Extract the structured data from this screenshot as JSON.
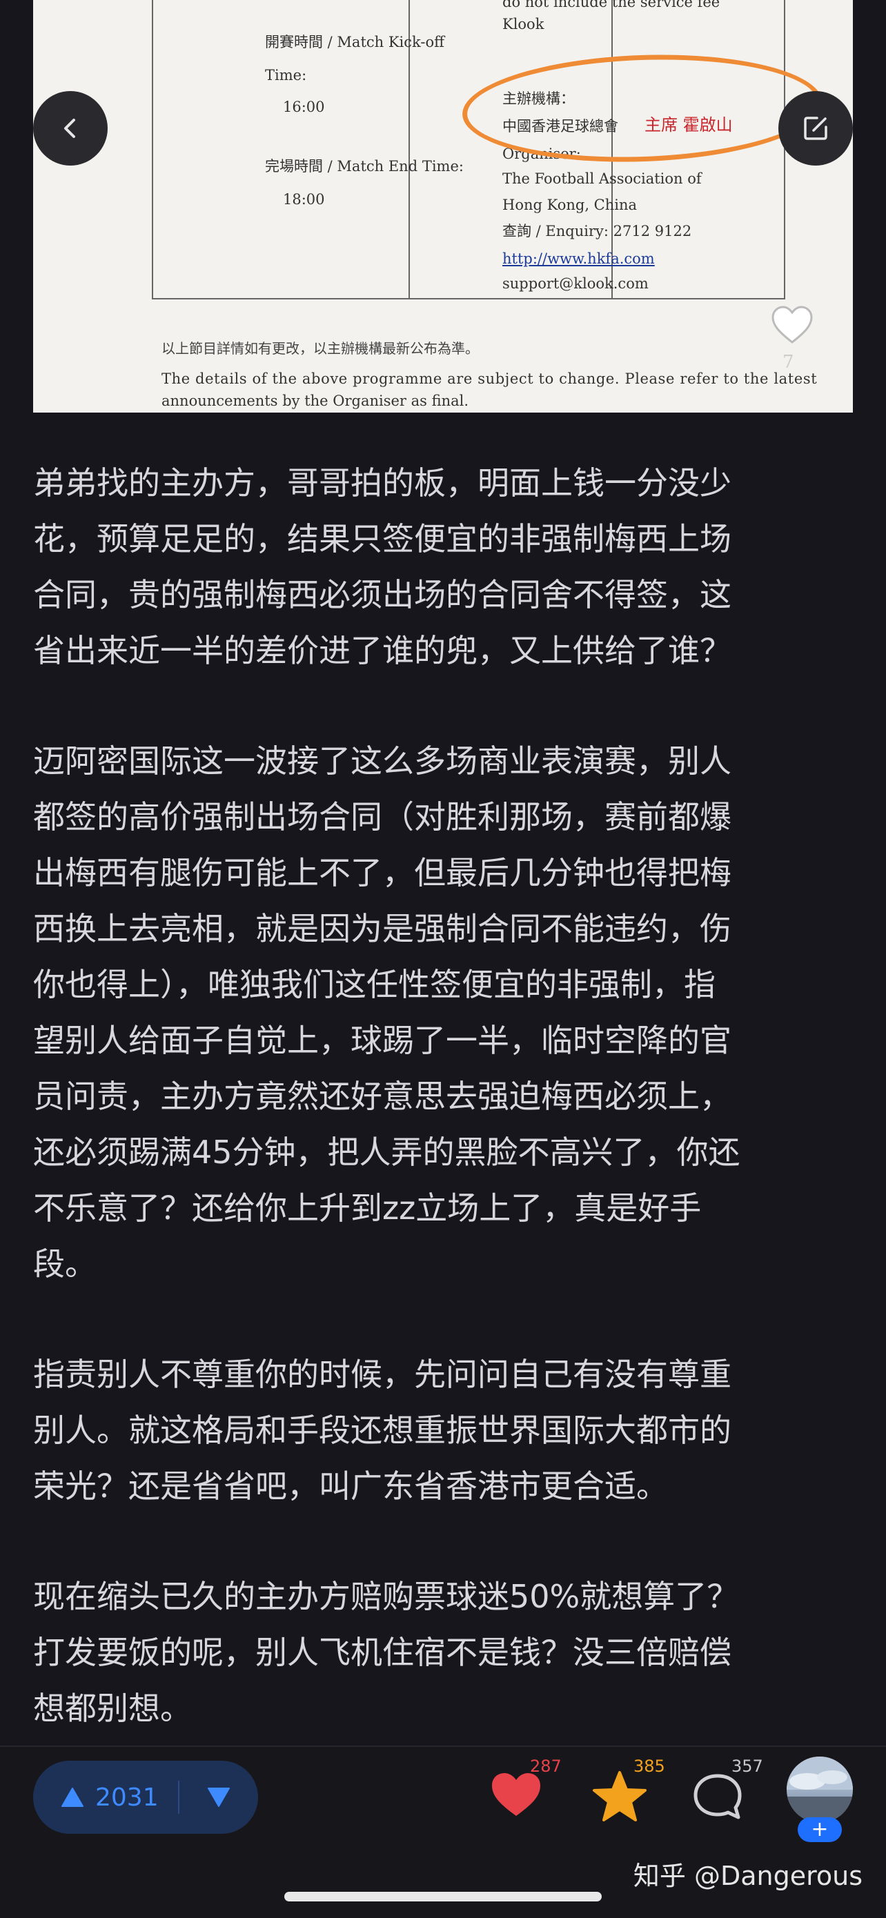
{
  "document_image": {
    "top_right_cell": [
      "do not include the service fee",
      "Klook"
    ],
    "kickoff_label": "開賽時間  / Match Kick-off",
    "kickoff_time_label": "Time:",
    "kickoff_time": "16:00",
    "end_label": "完場時間  / Match End Time:",
    "end_time": "18:00",
    "organiser_label_cn": "主辦機構：",
    "organiser_cn": "中國香港足球總會",
    "highlight_text": "主席 霍啟山",
    "organiser_label_en": "Organiser:",
    "organiser_en_1": "The Football Association of",
    "organiser_en_2": "Hong Kong, China",
    "enquiry": "查詢 / Enquiry: 2712 9122",
    "website": "http://www.hkfa.com",
    "support_email": "support@klook.com",
    "footnote_cn": "以上節目詳情如有更改，以主辦機構最新公布為準。",
    "footnote_en_1": "The details of the above programme are subject to change.  Please refer to the latest",
    "footnote_en_2": "announcements by the Organiser as final.",
    "image_like_count": "7"
  },
  "article": {
    "paragraphs": [
      "弟弟找的主办方，哥哥拍的板，明面上钱一分没少\n花，预算足足的，结果只签便宜的非强制梅西上场\n合同，贵的强制梅西必须出场的合同舍不得签，这\n省出来近一半的差价进了谁的兜，又上供给了谁？",
      "迈阿密国际这一波接了这么多场商业表演赛，别人\n都签的高价强制出场合同（对胜利那场，赛前都爆\n出梅西有腿伤可能上不了，但最后几分钟也得把梅\n西换上去亮相，就是因为是强制合同不能违约，伤\n你也得上），唯独我们这任性签便宜的非强制，指\n望别人给面子自觉上，球踢了一半，临时空降的官\n员问责，主办方竟然还好意思去强迫梅西必须上，\n还必须踢满45分钟，把人弄的黑脸不高兴了，你还\n不乐意了？还给你上升到zz立场上了，真是好手\n段。",
      "指责别人不尊重你的时候，先问问自己有没有尊重\n别人。就这格局和手段还想重振世界国际大都市的\n荣光？还是省省吧，叫广东省香港市更合适。",
      "现在缩头已久的主办方赔购票球迷50%就想算了？\n打发要饭的呢，别人飞机住宿不是钱？没三倍赔偿\n想都别想。"
    ]
  },
  "bottom_bar": {
    "upvote_count": "2031",
    "like_count": "287",
    "favorite_count": "385",
    "comment_count": "357",
    "watermark": "知乎 @Dangerous",
    "avatar_plus": "+"
  },
  "colors": {
    "background": "#16161c",
    "vote_pill": "#1d3156",
    "vote_accent": "#3d8bff",
    "like_red": "#e8434a",
    "star_orange": "#f3a21d",
    "annotation_orange": "#ef8a35"
  },
  "icons": [
    "back-arrow-icon",
    "edit-share-icon",
    "heart-icon",
    "up-triangle-icon",
    "down-triangle-icon",
    "star-icon",
    "comment-bubble-icon"
  ]
}
